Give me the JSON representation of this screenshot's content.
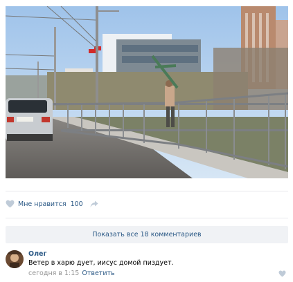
{
  "post": {
    "photo_alt": "",
    "like_label": "Мне нравится",
    "like_count": "100"
  },
  "comments": {
    "show_all_label": "Показать все 18 комментариев",
    "items": [
      {
        "author": "Олег",
        "text": "Ветер в харю дует, иисус домой пиздует.",
        "time": "сегодня в 1:15",
        "reply_label": "Ответить"
      }
    ]
  },
  "colors": {
    "link": "#2a5885",
    "muted": "#939393",
    "icon": "#bfcbd8",
    "panel": "#f0f2f5",
    "divider": "#e7e8ec"
  },
  "icons": [
    "heart-icon",
    "share-icon",
    "heart-icon"
  ]
}
